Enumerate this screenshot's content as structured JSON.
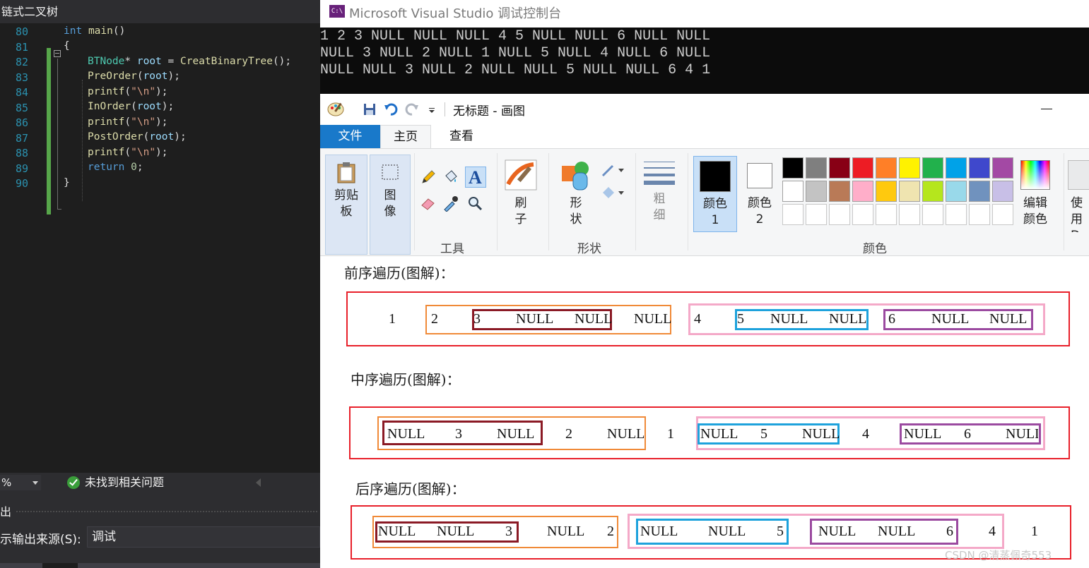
{
  "vs": {
    "tab_title": "链式二叉树",
    "lines": [
      {
        "num": "80",
        "code": "int main()"
      },
      {
        "num": "81",
        "code": "{"
      },
      {
        "num": "82",
        "code": "BTNode* root = CreatBinaryTree();"
      },
      {
        "num": "83",
        "code": "PreOrder(root);"
      },
      {
        "num": "84",
        "code": "printf(\"\\n\");"
      },
      {
        "num": "85",
        "code": "InOrder(root);"
      },
      {
        "num": "86",
        "code": "printf(\"\\n\");"
      },
      {
        "num": "87",
        "code": "PostOrder(root);"
      },
      {
        "num": "88",
        "code": "printf(\"\\n\");"
      },
      {
        "num": "89",
        "code": "return 0;"
      },
      {
        "num": "90",
        "code": "}"
      }
    ],
    "code_tokens": {
      "int": "int",
      "main": "main",
      "paren": "()",
      "btnode": "BTNode",
      "star": "*",
      "root": "root",
      "eq": " = ",
      "creat": "CreatBinaryTree",
      "semi_call": "();",
      "preorder": "PreOrder",
      "inorder": "InOrder",
      "postorder": "PostOrder",
      "printf": "printf",
      "nl_str": "\"\\n\"",
      "ret": "return",
      "zero": "0"
    },
    "zoom": "%",
    "issues": "未找到相关问题",
    "output_title": "出",
    "source_label": "示输出来源(S):",
    "source_value": "调试"
  },
  "console": {
    "title": "Microsoft Visual Studio 调试控制台",
    "icon_text": "C:\\",
    "lines": [
      "1 2 3 NULL NULL NULL 4 5 NULL NULL 6 NULL NULL",
      "NULL 3 NULL 2 NULL 1 NULL 5 NULL 4 NULL 6 NULL",
      "NULL NULL 3 NULL 2 NULL NULL 5 NULL NULL 6 4 1"
    ]
  },
  "paint": {
    "title": "无标题 - 画图",
    "tabs": {
      "file": "文件",
      "home": "主页",
      "view": "查看"
    },
    "ribbon": {
      "clipboard": "剪贴板",
      "image": "图像",
      "tools": "工具",
      "brushes": "刷子",
      "shapes_btn": "形状",
      "shapes_group": "形状",
      "size": "粗细",
      "color1": "颜色 1",
      "color2": "颜色 2",
      "edit_colors": "编辑颜色",
      "colors_group": "颜色",
      "paint3d": "使用 D 进"
    },
    "palette_row1": [
      "#000000",
      "#7f7f7f",
      "#880015",
      "#ed1c24",
      "#ff7f27",
      "#fff200",
      "#22b14c",
      "#00a2e8",
      "#3f48cc",
      "#a349a4"
    ],
    "palette_row2": [
      "#ffffff",
      "#c3c3c3",
      "#b97a57",
      "#ffaec9",
      "#ffc90e",
      "#efe4b0",
      "#b5e61d",
      "#99d9ea",
      "#7092be",
      "#c8bfe7"
    ]
  },
  "diagram": {
    "pre_caption": "前序遍历(图解)：",
    "in_caption": "中序遍历(图解)：",
    "post_caption": "后序遍历(图解)：",
    "pre": [
      "1",
      "2",
      "3",
      "NULL",
      "NULL",
      "NULL",
      "4",
      "5",
      "NULL",
      "NULL",
      "6",
      "NULL",
      "NULL"
    ],
    "in": [
      "NULL",
      "3",
      "NULL",
      "2",
      "NULL",
      "1",
      "NULL",
      "5",
      "NULL",
      "4",
      "NULL",
      "6",
      "NULL"
    ],
    "post": [
      "NULL",
      "NULL",
      "3",
      "NULL",
      "2",
      "NULL",
      "NULL",
      "5",
      "NULL",
      "NULL",
      "6",
      "4",
      "1"
    ]
  },
  "watermark": "CSDN @清蒸佩奇553"
}
